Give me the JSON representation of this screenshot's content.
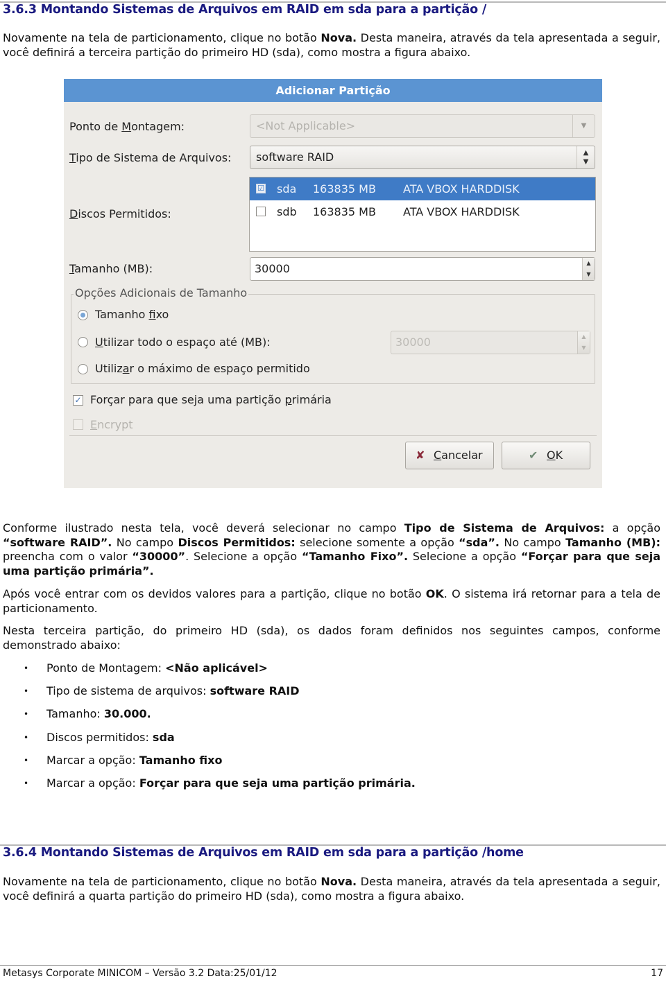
{
  "section1": {
    "heading": "3.6.3 Montando Sistemas de Arquivos em RAID em sda para a partição /",
    "intro": {
      "pre": "Novamente na tela de particionamento, clique no botão ",
      "bold": "Nova.",
      "post": " Desta maneira, através da tela apresentada a seguir, você definirá a terceira partição do primeiro HD (sda), como mostra a figura abaixo."
    }
  },
  "dialog": {
    "title": "Adicionar Partição",
    "mount_point": {
      "label_pre": "Ponto de ",
      "label_u": "M",
      "label_post": "ontagem:",
      "value": "<Not Applicable>"
    },
    "fs_type": {
      "label_u": "T",
      "label_post": "ipo de Sistema de Arquivos:",
      "value": "software RAID"
    },
    "allowed_disks": {
      "label_u": "D",
      "label_post": "iscos Permitidos:",
      "disks": [
        {
          "checked": "☑",
          "name": "sda",
          "size": "163835 MB",
          "model": "ATA VBOX HARDDISK"
        },
        {
          "checked": "",
          "name": "sdb",
          "size": "163835 MB",
          "model": "ATA VBOX HARDDISK"
        }
      ]
    },
    "size": {
      "label_u": "T",
      "label_post": "amanho (MB):",
      "value": "30000"
    },
    "size_options": {
      "legend": "Opções Adicionais de Tamanho",
      "fixed": {
        "pre": "Tamanho ",
        "u": "f",
        "post": "ixo",
        "selected": true
      },
      "fill_up_to": {
        "u": "U",
        "post": "tilizar todo o espaço até (MB):",
        "value": "30000"
      },
      "fill_max": {
        "pre": "Utiliz",
        "u": "a",
        "post": "r o máximo de espaço permitido"
      }
    },
    "force_primary": {
      "pre": "Forçar para que seja uma partição ",
      "u": "p",
      "post": "rimária",
      "checked": "✓"
    },
    "encrypt": {
      "u": "E",
      "post": "ncrypt"
    },
    "cancel": {
      "u": "C",
      "post": "ancelar",
      "icon": "✘"
    },
    "ok": {
      "u": "O",
      "post": "K",
      "icon": "✔"
    }
  },
  "para_instructions": {
    "t1": "Conforme ilustrado nesta tela, você deverá selecionar no campo ",
    "b1": "Tipo de Sistema de Arquivos:",
    "t2": " a opção ",
    "b2": "“software RAID”.",
    "t3": " No campo ",
    "b3": "Discos Permitidos:",
    "t4": " selecione somente a opção ",
    "b4": "“sda”.",
    "t5": " No campo ",
    "b5": "Tamanho (MB):",
    "t6": " preencha com o valor ",
    "b6": "“30000”",
    "t7": ". Selecione a opção ",
    "b7": "“Tamanho Fixo”.",
    "t8": " Selecione a opção ",
    "b8": "“Forçar para que seja uma partição primária”."
  },
  "para_after": {
    "pre": "Após você entrar com os devidos valores para a partição, clique no botão ",
    "bold": "OK",
    "post": ". O sistema irá retornar para a tela de particionamento."
  },
  "para_summary": "Nesta terceira partição, do primeiro HD (sda), os dados foram definidos nos seguintes campos, conforme demonstrado abaixo:",
  "summary_list": [
    {
      "label": "Ponto de Montagem: ",
      "value": "<Não aplicável>"
    },
    {
      "label": "Tipo de sistema de arquivos: ",
      "value": "software RAID"
    },
    {
      "label": "Tamanho: ",
      "value": "30.000."
    },
    {
      "label": "Discos permitidos: ",
      "value": "sda"
    },
    {
      "label": "Marcar a opção: ",
      "value": "Tamanho fixo"
    },
    {
      "label": "Marcar a opção: ",
      "value": "Forçar para que seja uma partição primária."
    }
  ],
  "bullet": "•",
  "section2": {
    "heading": "3.6.4 Montando Sistemas de Arquivos em RAID em sda para a partição /home",
    "intro": {
      "pre": "Novamente na tela de particionamento, clique no botão ",
      "bold": "Nova.",
      "post": " Desta maneira, através da tela apresentada a seguir, você definirá a quarta partição do primeiro HD (sda), como mostra a figura abaixo."
    }
  },
  "footer": {
    "left": "Metasys Corporate MINICOM – Versão 3.2 Data:25/01/12",
    "page": "17"
  },
  "colors": {
    "heading": "#1a1a80",
    "dialog_title_bar": "#5b94d2",
    "selection": "#3f7bc6"
  }
}
